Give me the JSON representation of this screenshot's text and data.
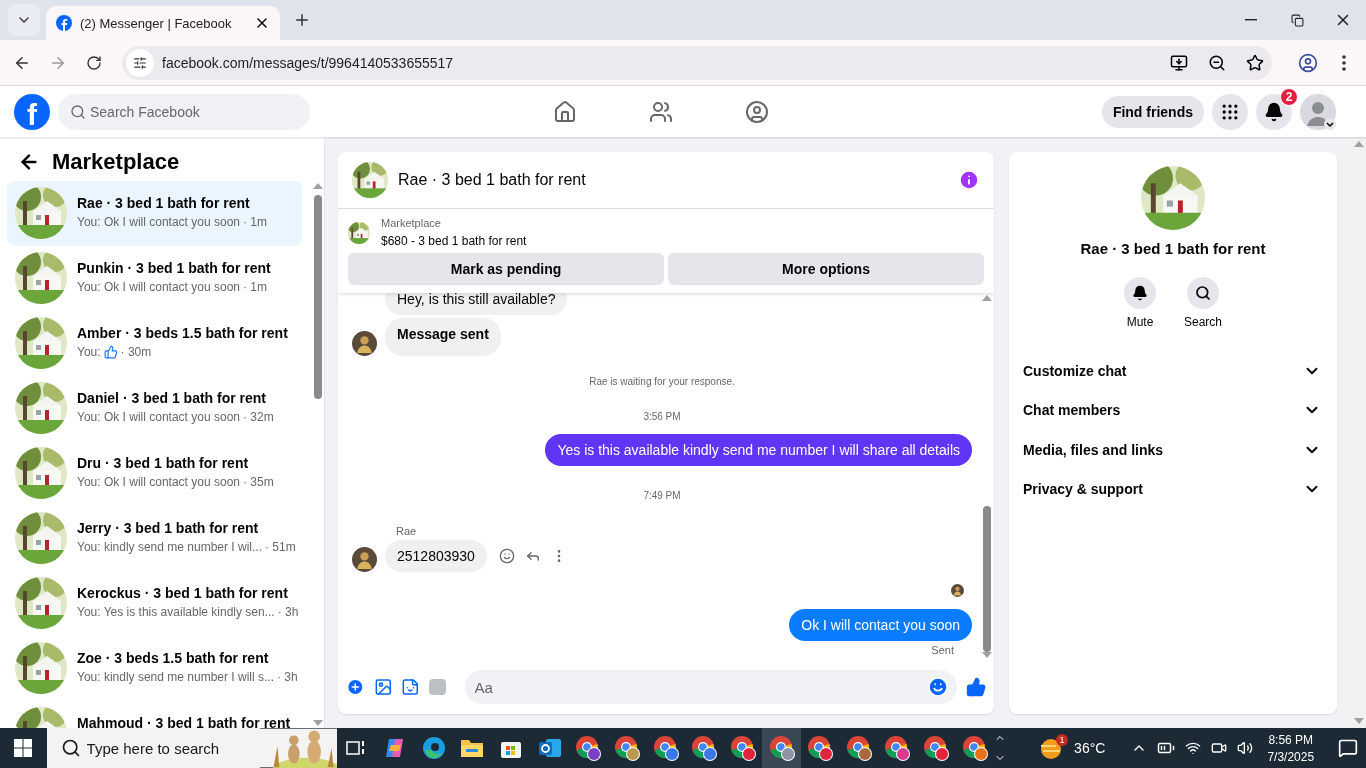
{
  "browser": {
    "tab_title": "(2) Messenger | Facebook",
    "url": "facebook.com/messages/t/9964140533655517"
  },
  "header": {
    "logo": "f",
    "search_placeholder": "Search Facebook",
    "find_friends": "Find friends",
    "notification_count": "2"
  },
  "sidebar": {
    "title": "Marketplace",
    "conversations": [
      {
        "name": "Rae · 3 bed 1 bath for rent",
        "kind": "text",
        "preview": "You: Ok I will contact you soon",
        "time": "· 1m",
        "selected": true
      },
      {
        "name": "Punkin · 3 bed 1 bath for rent",
        "kind": "text",
        "preview": "You: Ok I will contact you soon",
        "time": "· 1m",
        "selected": false
      },
      {
        "name": "Amber · 3 beds 1.5 bath for rent",
        "kind": "like",
        "preview": "You:",
        "time": "· 30m",
        "selected": false
      },
      {
        "name": "Daniel · 3 bed 1 bath for rent",
        "kind": "text",
        "preview": "You: Ok I will contact you soon",
        "time": "· 32m",
        "selected": false
      },
      {
        "name": "Dru · 3 bed 1 bath for rent",
        "kind": "text",
        "preview": "You: Ok I will contact you soon",
        "time": "· 35m",
        "selected": false
      },
      {
        "name": "Jerry · 3 bed 1 bath for rent",
        "kind": "text",
        "preview": "You: kindly send me number I wil...",
        "time": "· 51m",
        "selected": false
      },
      {
        "name": "Kerockus · 3 bed 1 bath for rent",
        "kind": "text",
        "preview": "You: Yes is this available kindly sen...",
        "time": "· 3h",
        "selected": false
      },
      {
        "name": "Zoe · 3 beds 1.5 bath for rent",
        "kind": "text",
        "preview": "You: kindly send me number I will s...",
        "time": "· 3h",
        "selected": false
      },
      {
        "name": "Mahmoud · 3 bed 1 bath for rent",
        "selected": false
      }
    ]
  },
  "chat": {
    "title": "Rae · 3 bed 1 bath for rent",
    "listing": {
      "label": "Marketplace",
      "title": "$680 - 3 bed 1 bath for rent"
    },
    "buttons": [
      "Mark as pending",
      "More options"
    ],
    "messages": [
      {
        "kind": "incoming",
        "text": "Hey, is this still available?",
        "bold": false,
        "avatar": false,
        "actions": false
      },
      {
        "kind": "incoming",
        "text": "Message sent",
        "bold": true,
        "avatar": true,
        "actions": false
      },
      {
        "kind": "notice",
        "text": "Rae is waiting for your response."
      },
      {
        "kind": "time",
        "text": "3:56 PM"
      },
      {
        "kind": "outgoing",
        "text": "Yes is this available kindly send me number I will share all details",
        "color": "#6135f5"
      },
      {
        "kind": "time",
        "text": "7:49 PM"
      },
      {
        "kind": "sender",
        "text": "Rae"
      },
      {
        "kind": "incoming",
        "text": "2512803930",
        "bold": false,
        "avatar": true,
        "actions": true
      },
      {
        "kind": "seen"
      },
      {
        "kind": "outgoing",
        "text": "Ok I will contact you soon",
        "color": "#0a7cff"
      },
      {
        "kind": "status",
        "text": "Sent"
      }
    ],
    "composer_placeholder": "Aa"
  },
  "details": {
    "name": "Rae · 3 bed 1 bath for rent",
    "actions": [
      {
        "kind": "mute",
        "label": "Mute"
      },
      {
        "kind": "search",
        "label": "Search"
      }
    ],
    "sections": [
      {
        "label": "Customize chat",
        "expanded": false
      },
      {
        "label": "Chat members",
        "expanded": false
      },
      {
        "label": "Media, files and links",
        "expanded": false
      },
      {
        "label": "Privacy & support",
        "expanded": false
      }
    ]
  },
  "taskbar": {
    "search_placeholder": "Type here to search",
    "apps": [
      {
        "kind": "taskview",
        "selected": false
      },
      {
        "kind": "copilot",
        "selected": false
      },
      {
        "kind": "edge",
        "selected": false
      },
      {
        "kind": "files",
        "selected": false
      },
      {
        "kind": "store",
        "selected": false
      },
      {
        "kind": "outlook",
        "selected": false
      },
      {
        "kind": "chrome",
        "color": "#7b3fc4",
        "selected": false
      },
      {
        "kind": "chrome",
        "color": "#b89a4c",
        "selected": false
      },
      {
        "kind": "chrome",
        "color": "#3b78e7",
        "selected": false
      },
      {
        "kind": "chrome",
        "color": "#3b78e7",
        "selected": false
      },
      {
        "kind": "chrome",
        "color": "#e0243b",
        "selected": false
      },
      {
        "kind": "chrome",
        "color": "#8d95a5",
        "selected": true
      },
      {
        "kind": "chrome",
        "color": "#e0243b",
        "selected": false
      },
      {
        "kind": "chrome",
        "color": "#a9683d",
        "selected": false
      },
      {
        "kind": "chrome",
        "color": "#d93a8c",
        "selected": false
      },
      {
        "kind": "chrome",
        "color": "#e0243b",
        "selected": false
      },
      {
        "kind": "chrome",
        "color": "#e8711a",
        "selected": false
      }
    ],
    "weather": "36°C",
    "weather_badge": "1",
    "time": "8:56 PM",
    "date": "7/3/2025"
  }
}
